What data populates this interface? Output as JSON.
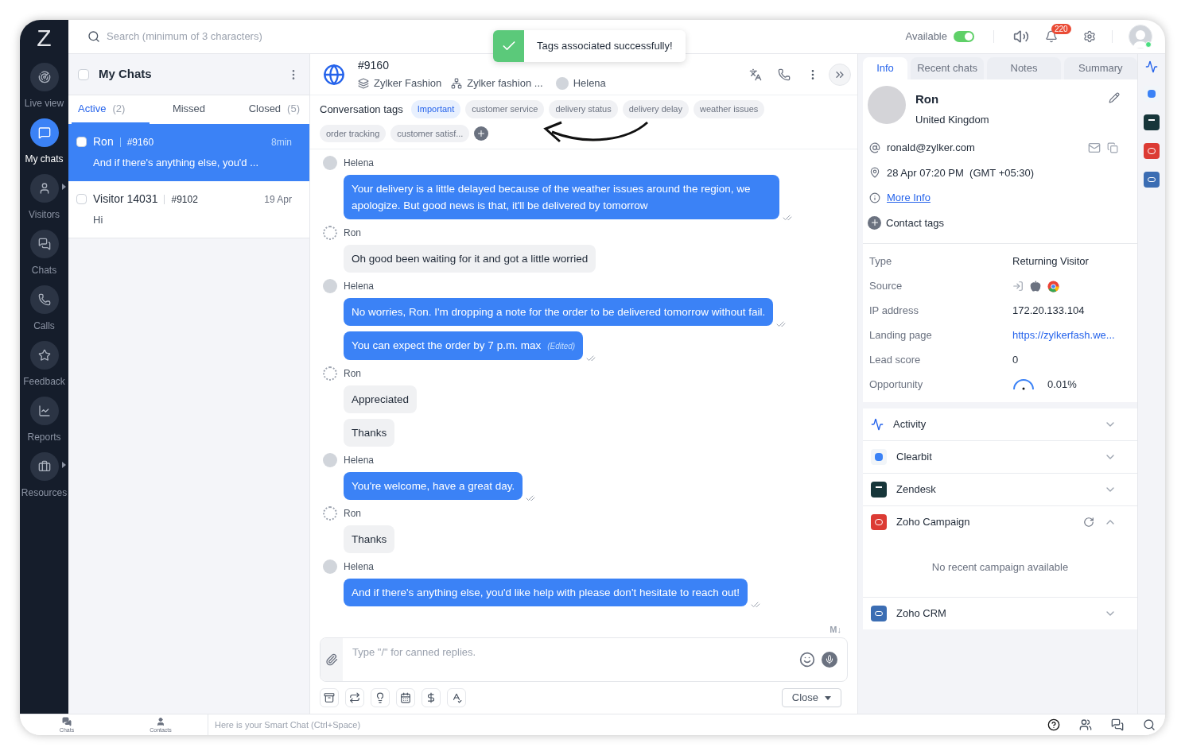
{
  "nav": {
    "logo": "Z",
    "items": [
      {
        "label": "Live view",
        "selected": false,
        "submenu": false
      },
      {
        "label": "My chats",
        "selected": true,
        "submenu": false
      },
      {
        "label": "Visitors",
        "selected": false,
        "submenu": true
      },
      {
        "label": "Chats",
        "selected": false,
        "submenu": false
      },
      {
        "label": "Calls",
        "selected": false,
        "submenu": false
      },
      {
        "label": "Feedback",
        "selected": false,
        "submenu": false
      },
      {
        "label": "Reports",
        "selected": false,
        "submenu": false
      },
      {
        "label": "Resources",
        "selected": false,
        "submenu": true
      }
    ]
  },
  "top_bar": {
    "search": {
      "placeholder": "Search (minimum of 3 characters)"
    },
    "status": {
      "label": "Available",
      "on": true
    },
    "notifications": "220"
  },
  "toast": {
    "message": "Tags associated successfully!"
  },
  "chat_list": {
    "title": "My Chats",
    "select_all_checked": false,
    "tabs": [
      {
        "label": "Active",
        "count": "(2)",
        "selected": true
      },
      {
        "label": "Missed",
        "selected": false
      },
      {
        "label": "Closed",
        "count": "(5)",
        "selected": false
      }
    ],
    "items": [
      {
        "name": "Ron",
        "id": "#9160",
        "time": "8min",
        "preview": "And if there's anything else, you'd ...",
        "selected": true,
        "checked": false
      },
      {
        "name": "Visitor 14031",
        "id": "#9102",
        "time": "19 Apr",
        "preview": "Hi",
        "selected": false,
        "checked": false
      }
    ]
  },
  "conversation": {
    "id": "#9160",
    "brand": "Zylker Fashion",
    "department": "Zylker fashion ...",
    "agent": "Helena",
    "tags_label": "Conversation tags",
    "tags": [
      {
        "label": "Important",
        "highlighted": true
      },
      {
        "label": "customer service",
        "highlighted": false
      },
      {
        "label": "delivery status",
        "highlighted": false
      },
      {
        "label": "delivery delay",
        "highlighted": false
      },
      {
        "label": "weather issues",
        "highlighted": false
      },
      {
        "label": "order tracking",
        "highlighted": false
      },
      {
        "label": "customer satisf...",
        "highlighted": false
      }
    ],
    "messages": [
      {
        "sender": "Helena",
        "kind": "agent",
        "bubbles": [
          {
            "text": "Your delivery is a little delayed because of the weather issues around the region, we apologize. But good news is that, it'll be delivered by tomorrow"
          }
        ]
      },
      {
        "sender": "Ron",
        "kind": "visitor",
        "bubbles": [
          {
            "text": "Oh good been waiting for it and got a little worried"
          }
        ]
      },
      {
        "sender": "Helena",
        "kind": "agent",
        "bubbles": [
          {
            "text": "No worries, Ron. I'm dropping a note for the order to be delivered tomorrow without fail."
          },
          {
            "text": "You can expect the order by 7 p.m. max",
            "note": "(Edited)"
          }
        ]
      },
      {
        "sender": "Ron",
        "kind": "visitor",
        "bubbles": [
          {
            "text": "Appreciated"
          },
          {
            "text": "Thanks"
          }
        ]
      },
      {
        "sender": "Helena",
        "kind": "agent",
        "bubbles": [
          {
            "text": "You're welcome, have a great day."
          }
        ]
      },
      {
        "sender": "Ron",
        "kind": "visitor",
        "bubbles": [
          {
            "text": "Thanks"
          }
        ]
      },
      {
        "sender": "Helena",
        "kind": "agent",
        "bubbles": [
          {
            "text": "And if there's anything else, you'd like help with please don't hesitate to reach out!"
          }
        ]
      }
    ],
    "composer": {
      "placeholder": "Type \"/\" for canned replies.",
      "markdown_label": "M↓"
    },
    "close_button": "Close"
  },
  "details": {
    "tabs": [
      {
        "label": "Info",
        "selected": true
      },
      {
        "label": "Recent chats",
        "selected": false
      },
      {
        "label": "Notes",
        "selected": false
      },
      {
        "label": "Summary",
        "selected": false
      }
    ],
    "visitor": {
      "name": "Ron",
      "country": "United Kingdom",
      "email": "ronald@zylker.com",
      "local_time": "28 Apr 07:20 PM  (GMT +05:30)",
      "more_info": "More Info",
      "contact_tags": "Contact tags"
    },
    "fields": [
      {
        "label": "Type",
        "kind": "text",
        "value": "Returning Visitor"
      },
      {
        "label": "Source",
        "kind": "icons"
      },
      {
        "label": "IP address",
        "kind": "text",
        "value": "172.20.133.104"
      },
      {
        "label": "Landing page",
        "kind": "link",
        "value": "https://zylkerfash.we..."
      },
      {
        "label": "Lead score",
        "kind": "text",
        "value": "0"
      },
      {
        "label": "Opportunity",
        "kind": "gauge",
        "value": "0.01%"
      }
    ],
    "integrations": [
      {
        "label": "Activity",
        "expanded": false
      },
      {
        "label": "Clearbit",
        "expanded": false
      },
      {
        "label": "Zendesk",
        "expanded": false
      },
      {
        "label": "Zoho Campaign",
        "expanded": true,
        "body": "No recent campaign available"
      },
      {
        "label": "Zoho CRM",
        "expanded": false
      }
    ]
  },
  "bottom_bar": {
    "items": [
      "Chats",
      "Contacts"
    ],
    "smart_chat": {
      "placeholder": "Here is your Smart Chat (Ctrl+Space)"
    }
  }
}
